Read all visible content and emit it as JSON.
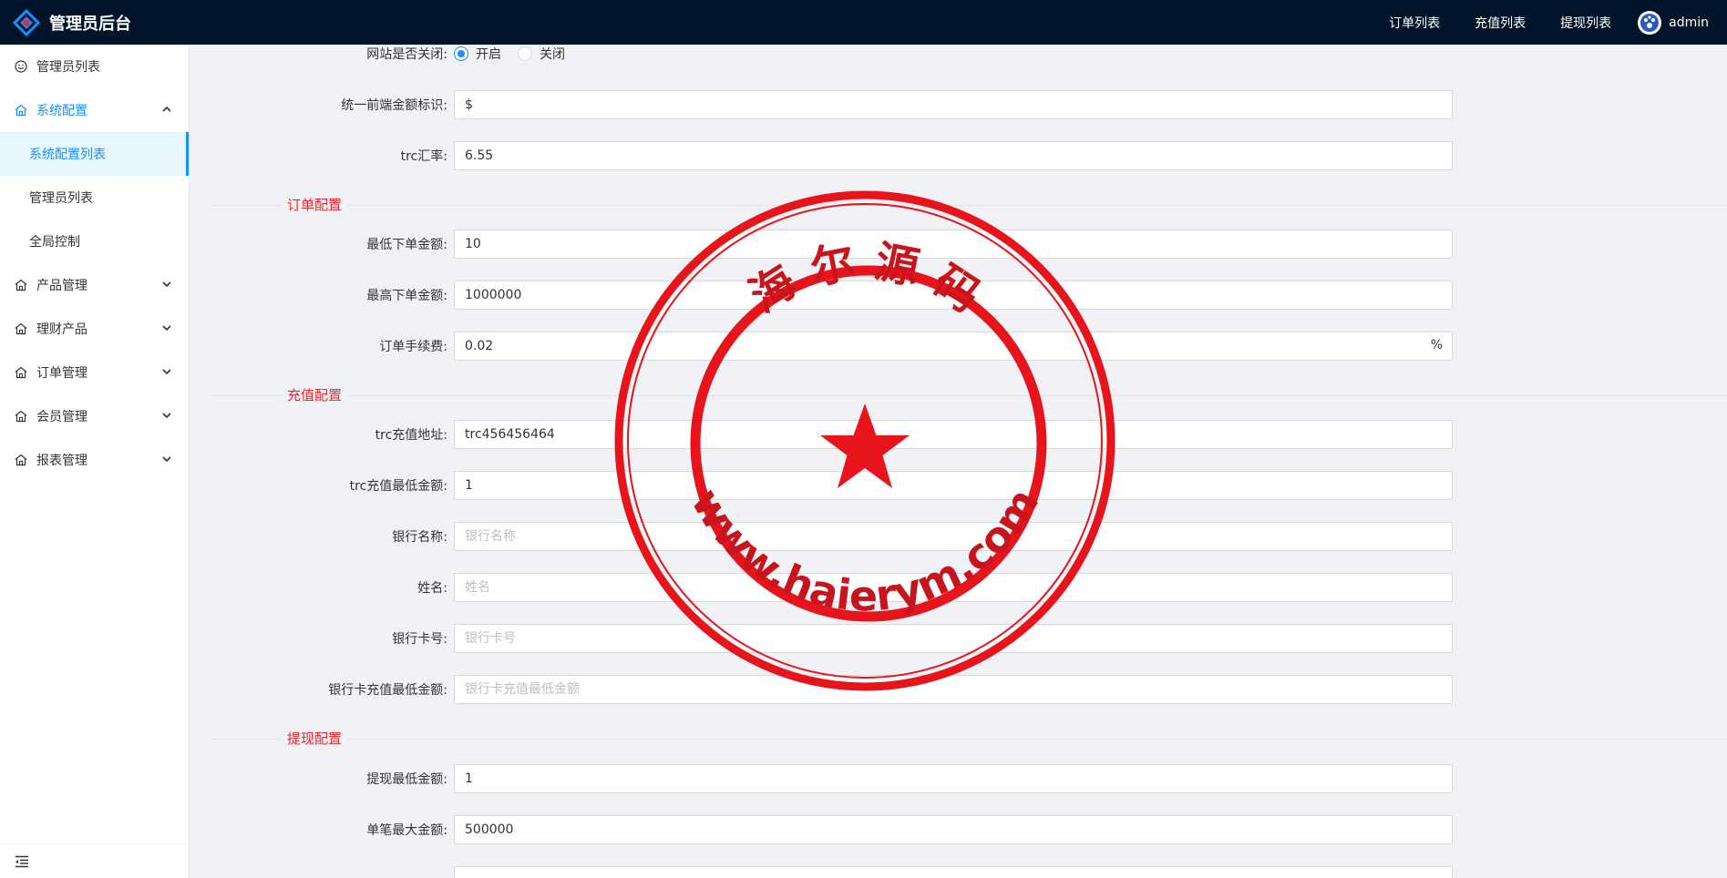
{
  "header": {
    "title": "管理员后台",
    "nav": [
      "订单列表",
      "充值列表",
      "提现列表"
    ],
    "user": "admin"
  },
  "sidebar": {
    "items": [
      {
        "label": "管理员列表",
        "icon": "smile-icon"
      },
      {
        "label": "系统配置",
        "icon": "home-icon",
        "expanded": true,
        "children": [
          "系统配置列表",
          "管理员列表",
          "全局控制"
        ],
        "selected_child": "系统配置列表"
      },
      {
        "label": "产品管理",
        "icon": "home-icon"
      },
      {
        "label": "理财产品",
        "icon": "home-icon"
      },
      {
        "label": "订单管理",
        "icon": "home-icon"
      },
      {
        "label": "会员管理",
        "icon": "home-icon"
      },
      {
        "label": "报表管理",
        "icon": "home-icon"
      }
    ]
  },
  "form": {
    "site_closed": {
      "label": "网站是否关闭:",
      "options": [
        "开启",
        "关闭"
      ],
      "selected": "开启"
    },
    "currency_symbol": {
      "label": "统一前端金额标识:",
      "value": "$"
    },
    "trc_rate": {
      "label": "trc汇率:",
      "value": "6.55"
    },
    "order_section": "订单配置",
    "min_order": {
      "label": "最低下单金额:",
      "value": "10"
    },
    "max_order": {
      "label": "最高下单金额:",
      "value": "1000000"
    },
    "order_fee": {
      "label": "订单手续费:",
      "value": "0.02",
      "suffix": "%"
    },
    "recharge_section": "充值配置",
    "trc_address": {
      "label": "trc充值地址:",
      "value": "trc456456464"
    },
    "trc_min": {
      "label": "trc充值最低金额:",
      "value": "1"
    },
    "bank_name": {
      "label": "银行名称:",
      "placeholder": "银行名称"
    },
    "holder_name": {
      "label": "姓名:",
      "placeholder": "姓名"
    },
    "bank_card": {
      "label": "银行卡号:",
      "placeholder": "银行卡号"
    },
    "bank_min": {
      "label": "银行卡充值最低金额:",
      "placeholder": "银行卡充值最低金额"
    },
    "withdraw_section": "提现配置",
    "withdraw_min": {
      "label": "提现最低金额:",
      "value": "1"
    },
    "withdraw_max": {
      "label": "单笔最大金额:",
      "value": "500000"
    }
  },
  "watermark": {
    "top_text": "海 尔 源 码",
    "bottom_text": "www.haierym.com",
    "color": "#e8141c"
  },
  "colors": {
    "accent": "#1890ff",
    "header_bg": "#001529",
    "section_title": "#f5222d"
  }
}
